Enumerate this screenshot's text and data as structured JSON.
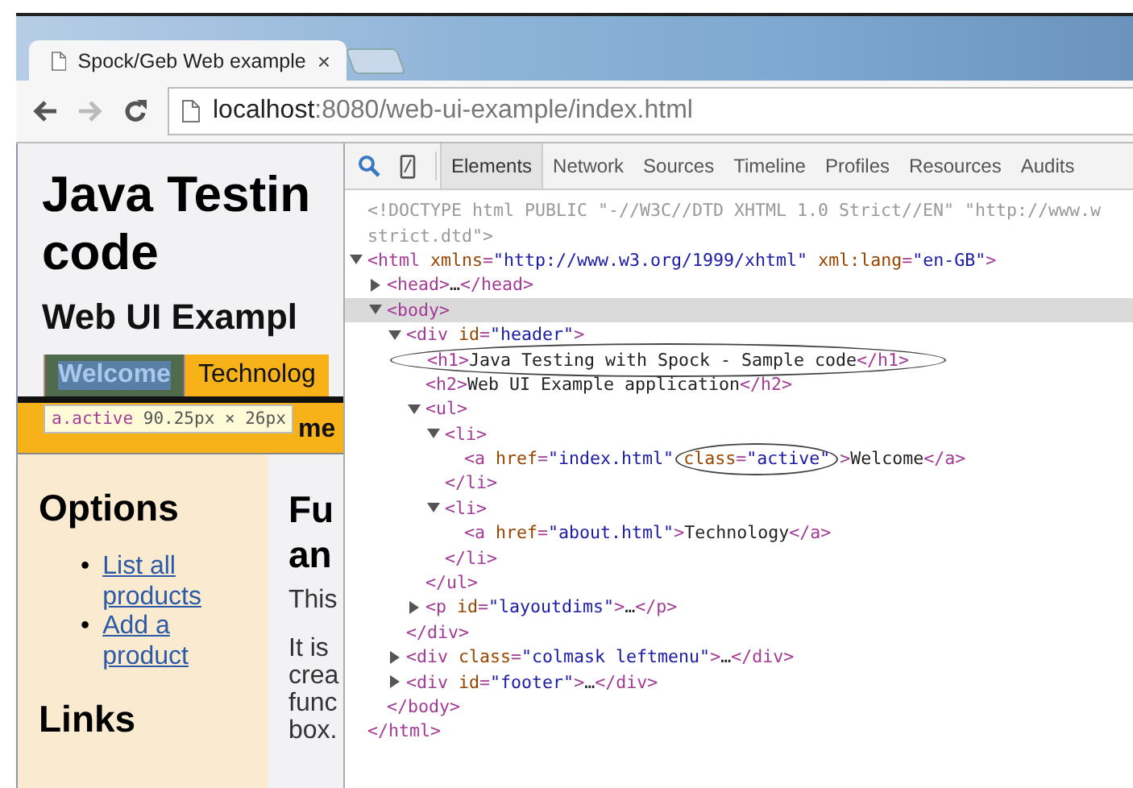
{
  "browser": {
    "tab_title": "Spock/Geb Web example",
    "tab_close": "×",
    "url_host": "localhost",
    "url_rest": ":8080/web-ui-example/index.html",
    "forward_disabled": true
  },
  "page": {
    "title_lines": [
      "Java Testin",
      "code"
    ],
    "subtitle": "Web UI Exampl",
    "nav": [
      {
        "label": "Welcome",
        "selected": true
      },
      {
        "label": "Technolog",
        "selected": false
      }
    ],
    "current_page_visible": "me",
    "inspect_tooltip": {
      "selector": "a.active",
      "size": "90.25px × 26px"
    },
    "sidebar": {
      "heading": "Options",
      "bullet": "•",
      "links": [
        "List all products",
        "Add a product"
      ],
      "heading_2": "Links"
    },
    "main": {
      "heading_lines": [
        "Fu",
        "an"
      ],
      "intro": "This",
      "paragraph_lines": [
        "It is",
        "crea",
        "func",
        "box."
      ]
    }
  },
  "devtools": {
    "tabs": [
      {
        "label": "Elements",
        "selected": true
      },
      {
        "label": "Network",
        "selected": false
      },
      {
        "label": "Sources",
        "selected": false
      },
      {
        "label": "Timeline",
        "selected": false
      },
      {
        "label": "Profiles",
        "selected": false
      },
      {
        "label": "Resources",
        "selected": false
      },
      {
        "label": "Audits",
        "selected": false
      }
    ],
    "dom": [
      {
        "tokens": [
          {
            "kind": "doc",
            "t": "<!DOCTYPE html PUBLIC \"-//W3C//DTD XHTML 1.0 Strict//EN\" \"http://www.w"
          }
        ]
      },
      {
        "tokens": [
          {
            "kind": "doc",
            "t": "strict.dtd\">"
          }
        ]
      },
      {
        "expanded": true,
        "tokens": [
          {
            "kind": "tag",
            "t": "<html "
          },
          {
            "kind": "attr",
            "t": "xmlns"
          },
          {
            "kind": "tag",
            "t": "="
          },
          {
            "kind": "val",
            "t": "\"http://www.w3.org/1999/xhtml\""
          },
          {
            "kind": "attr",
            "t": " xml:lang"
          },
          {
            "kind": "tag",
            "t": "="
          },
          {
            "kind": "val",
            "t": "\"en-GB\""
          },
          {
            "kind": "tag",
            "t": ">"
          }
        ],
        "children": [
          {
            "expanded": false,
            "tokens": [
              {
                "kind": "tag",
                "t": "<head>"
              },
              {
                "kind": "text",
                "t": "…"
              },
              {
                "kind": "tag",
                "t": "</head>"
              }
            ]
          },
          {
            "expanded": true,
            "selected": true,
            "tokens": [
              {
                "kind": "tag",
                "t": "<body>"
              }
            ],
            "children": [
              {
                "expanded": true,
                "tokens": [
                  {
                    "kind": "tag",
                    "t": "<div "
                  },
                  {
                    "kind": "attr",
                    "t": "id"
                  },
                  {
                    "kind": "tag",
                    "t": "="
                  },
                  {
                    "kind": "val",
                    "t": "\"header\""
                  },
                  {
                    "kind": "tag",
                    "t": ">"
                  }
                ],
                "children": [
                  {
                    "circled": true,
                    "tokens": [
                      {
                        "kind": "tag",
                        "t": "<h1>"
                      },
                      {
                        "kind": "text",
                        "t": "Java Testing with Spock - Sample code"
                      },
                      {
                        "kind": "tag",
                        "t": "</h1>"
                      }
                    ]
                  },
                  {
                    "tokens": [
                      {
                        "kind": "tag",
                        "t": "<h2>"
                      },
                      {
                        "kind": "text",
                        "t": "Web UI Example application"
                      },
                      {
                        "kind": "tag",
                        "t": "</h2>"
                      }
                    ]
                  },
                  {
                    "expanded": true,
                    "tokens": [
                      {
                        "kind": "tag",
                        "t": "<ul>"
                      }
                    ],
                    "close": "</ul>",
                    "children": [
                      {
                        "expanded": true,
                        "tokens": [
                          {
                            "kind": "tag",
                            "t": "<li>"
                          }
                        ],
                        "close": "</li>",
                        "children": [
                          {
                            "tokens": [
                              {
                                "kind": "tag",
                                "t": "<a "
                              },
                              {
                                "kind": "attr",
                                "t": "href"
                              },
                              {
                                "kind": "tag",
                                "t": "="
                              },
                              {
                                "kind": "val",
                                "t": "\"index.html\""
                              },
                              {
                                "kind": "group",
                                "circled": true,
                                "tokens": [
                                  {
                                    "kind": "attr",
                                    "t": "class"
                                  },
                                  {
                                    "kind": "tag",
                                    "t": "="
                                  },
                                  {
                                    "kind": "val",
                                    "t": "\"active\""
                                  }
                                ]
                              },
                              {
                                "kind": "tag",
                                "t": ">"
                              },
                              {
                                "kind": "text",
                                "t": "Welcome"
                              },
                              {
                                "kind": "tag",
                                "t": "</a>"
                              }
                            ]
                          }
                        ]
                      },
                      {
                        "expanded": true,
                        "tokens": [
                          {
                            "kind": "tag",
                            "t": "<li>"
                          }
                        ],
                        "close": "</li>",
                        "children": [
                          {
                            "tokens": [
                              {
                                "kind": "tag",
                                "t": "<a "
                              },
                              {
                                "kind": "attr",
                                "t": "href"
                              },
                              {
                                "kind": "tag",
                                "t": "="
                              },
                              {
                                "kind": "val",
                                "t": "\"about.html\""
                              },
                              {
                                "kind": "tag",
                                "t": ">"
                              },
                              {
                                "kind": "text",
                                "t": "Technology"
                              },
                              {
                                "kind": "tag",
                                "t": "</a>"
                              }
                            ]
                          }
                        ]
                      }
                    ]
                  },
                  {
                    "expanded": false,
                    "tokens": [
                      {
                        "kind": "tag",
                        "t": "<p "
                      },
                      {
                        "kind": "attr",
                        "t": "id"
                      },
                      {
                        "kind": "tag",
                        "t": "="
                      },
                      {
                        "kind": "val",
                        "t": "\"layoutdims\""
                      },
                      {
                        "kind": "tag",
                        "t": ">"
                      },
                      {
                        "kind": "text",
                        "t": "…"
                      },
                      {
                        "kind": "tag",
                        "t": "</p>"
                      }
                    ]
                  }
                ],
                "close": "</div>"
              },
              {
                "expanded": false,
                "tokens": [
                  {
                    "kind": "tag",
                    "t": "<div "
                  },
                  {
                    "kind": "attr",
                    "t": "class"
                  },
                  {
                    "kind": "tag",
                    "t": "="
                  },
                  {
                    "kind": "val",
                    "t": "\"colmask leftmenu\""
                  },
                  {
                    "kind": "tag",
                    "t": ">"
                  },
                  {
                    "kind": "text",
                    "t": "…"
                  },
                  {
                    "kind": "tag",
                    "t": "</div>"
                  }
                ]
              },
              {
                "expanded": false,
                "tokens": [
                  {
                    "kind": "tag",
                    "t": "<div "
                  },
                  {
                    "kind": "attr",
                    "t": "id"
                  },
                  {
                    "kind": "tag",
                    "t": "="
                  },
                  {
                    "kind": "val",
                    "t": "\"footer\""
                  },
                  {
                    "kind": "tag",
                    "t": ">"
                  },
                  {
                    "kind": "text",
                    "t": "…"
                  },
                  {
                    "kind": "tag",
                    "t": "</div>"
                  }
                ]
              }
            ],
            "close": "</body>"
          }
        ],
        "close": "</html>"
      }
    ]
  }
}
